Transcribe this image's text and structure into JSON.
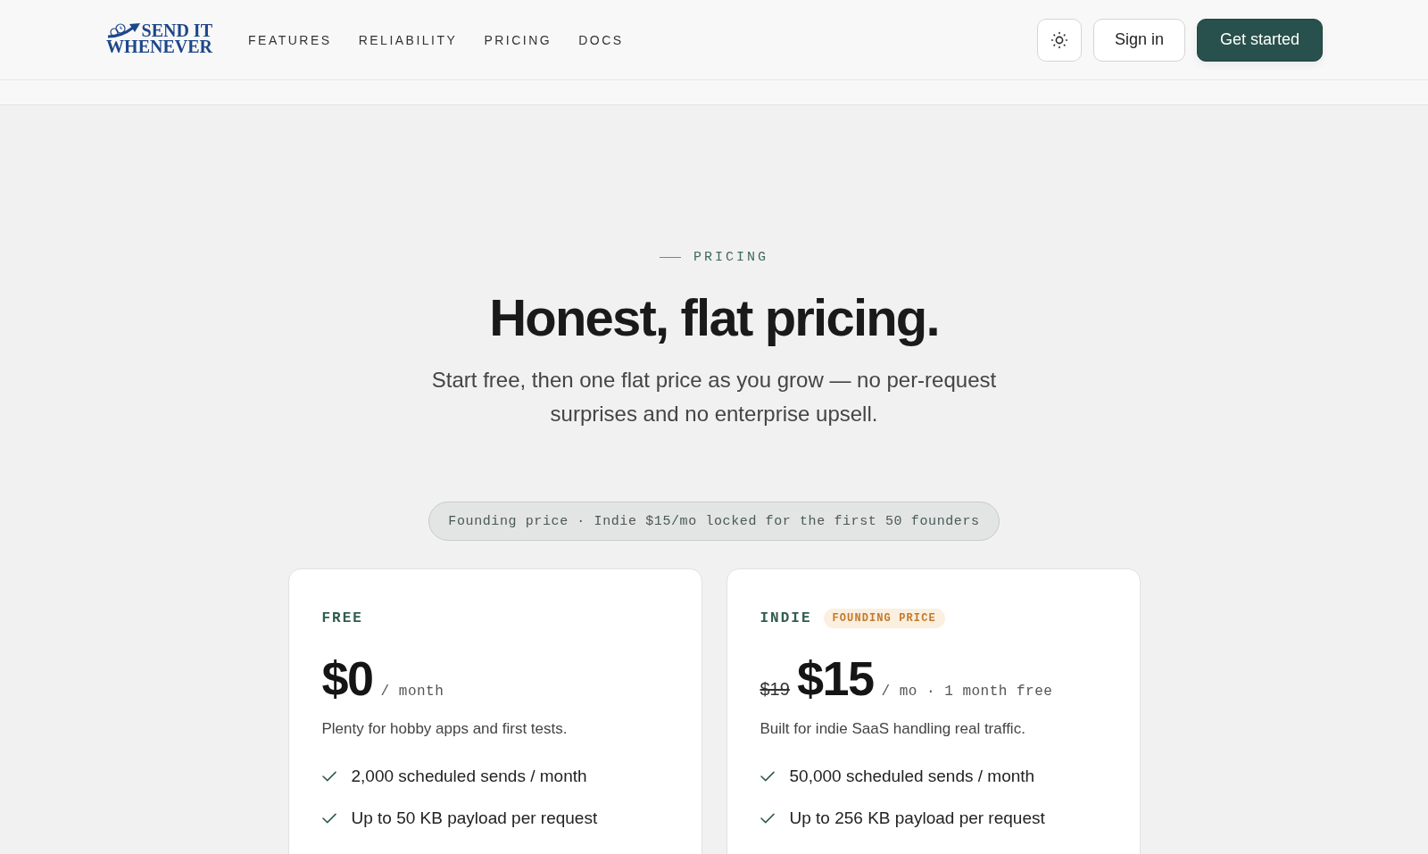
{
  "header": {
    "logo": {
      "lines": [
        "SEND IT",
        "WHENEVER"
      ]
    },
    "nav": [
      {
        "label": "FEATURES"
      },
      {
        "label": "RELIABILITY"
      },
      {
        "label": "PRICING"
      },
      {
        "label": "DOCS"
      }
    ],
    "buttons": [
      {
        "label": "Sign in",
        "kind": "secondary"
      },
      {
        "label": "Get started",
        "kind": "primary"
      }
    ]
  },
  "pricing": {
    "eyebrow": "PRICING",
    "title": "Honest, flat pricing.",
    "subtitle": "Start free, then one flat price as you grow — no per-request surprises and no enterprise upsell.",
    "notice": "Founding price · Indie $15/mo locked for the first 50 founders",
    "plans": [
      {
        "name": "FREE",
        "price": "$0",
        "period": "/ month",
        "description": "Plenty for hobby apps and first tests.",
        "features": [
          "2,000 scheduled sends / month",
          "Up to 50 KB payload per request"
        ]
      },
      {
        "name": "INDIE",
        "badge": "FOUNDING PRICE",
        "original_price": "$19",
        "price": "$15",
        "period": "/ mo · 1 month free",
        "description": "Built for indie SaaS handling real traffic.",
        "features": [
          "50,000 scheduled sends / month",
          "Up to 256 KB payload per request"
        ]
      }
    ]
  }
}
